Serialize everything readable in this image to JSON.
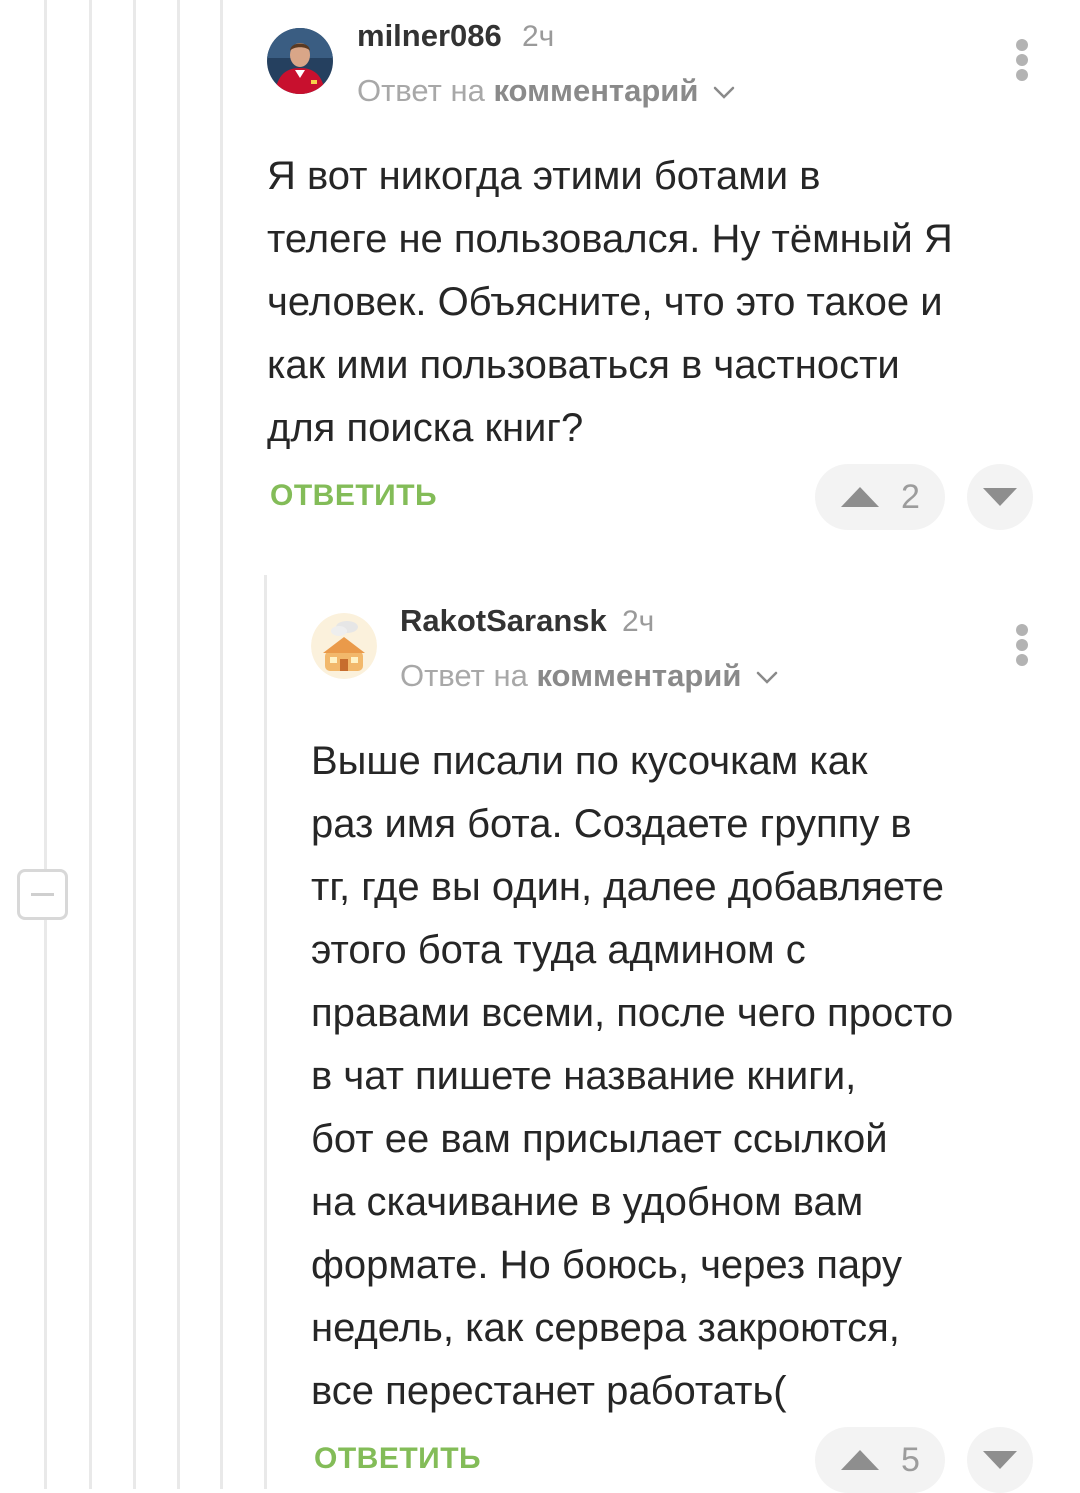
{
  "comments": [
    {
      "username": "milner086",
      "time": "2ч",
      "reply_prefix": "Ответ на",
      "reply_link": "комментарий",
      "text_lines": [
        "Я вот никогда этими ботами в",
        "телеге не пользовался. Ну тёмный Я",
        "человек. Объясните, что это такое и",
        "как ими пользоваться в частности",
        "для поиска книг?"
      ],
      "reply_label": "ОТВЕТИТЬ",
      "rating": "2"
    },
    {
      "username": "RakotSaransk",
      "time": "2ч",
      "reply_prefix": "Ответ на",
      "reply_link": "комментарий",
      "text_lines": [
        "Выше писали по кусочкам как",
        "раз имя бота. Создаете группу в",
        "тг, где вы один, далее добавляете",
        "этого бота туда админом с",
        "правами всеми, после чего просто",
        "в чат пишете название книги,",
        "бот ее вам присылает ссылкой",
        "на скачивание в удобном вам",
        "формате. Но боюсь, через пару",
        "недель, как сервера закроются,",
        "все перестанет работать("
      ],
      "reply_label": "ОТВЕТИТЬ",
      "rating": "5"
    }
  ],
  "icons": {
    "more": "vertical-dots-icon",
    "vote_up": "triangle-up-icon",
    "vote_down": "triangle-down-icon",
    "reply_chevron": "chevron-down-icon",
    "collapse": "minus-icon"
  },
  "colors": {
    "reply_action": "#83bc58",
    "thread_line": "#e9e9e9",
    "muted_text": "#9a9a9a",
    "vote_bg": "#f3f3f3"
  }
}
